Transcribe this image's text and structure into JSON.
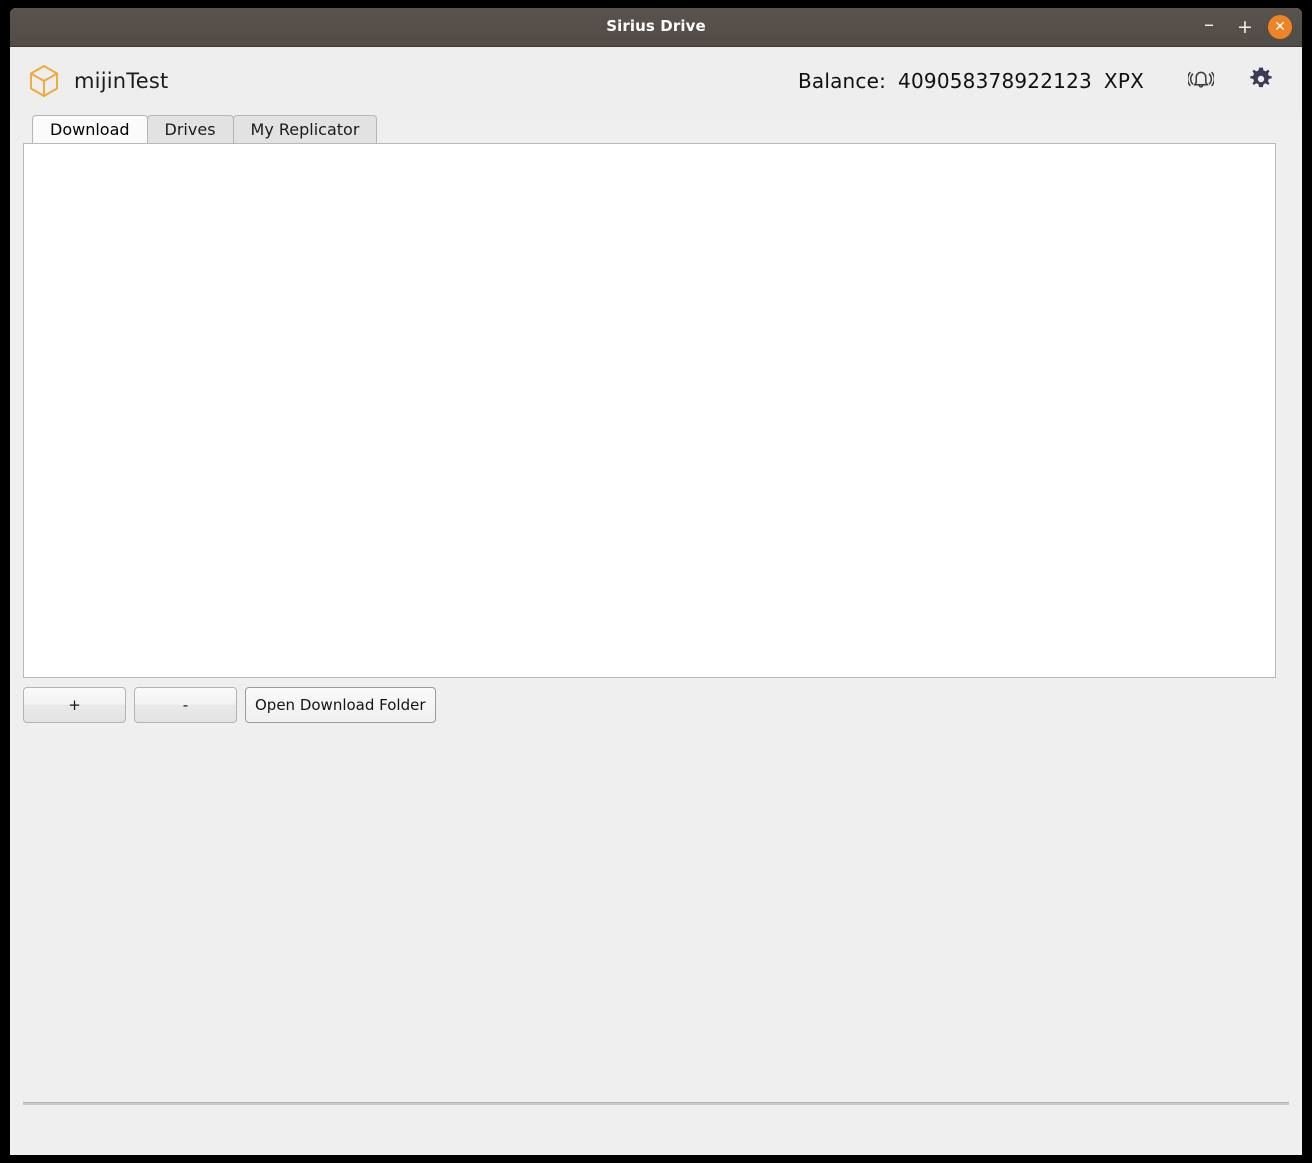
{
  "window": {
    "title": "Sirius Drive",
    "controls": {
      "minimize_label": "–",
      "maximize_label": "+",
      "close_label": "✕"
    },
    "colors": {
      "titlebar_bg": "#564e49",
      "close_button_bg": "#eb8527",
      "brand_accent": "#f0a93a",
      "header_bg": "#eeeeee",
      "panel_bg": "#fafafa"
    }
  },
  "header": {
    "brand_icon": "cube-icon",
    "brand_name": "mijinTest",
    "balance": {
      "label": "Balance:",
      "value": "409058378922123",
      "unit": "XPX"
    },
    "notifications_icon": "bell-ringing-icon",
    "settings_icon": "gear-icon"
  },
  "tabs": [
    {
      "label": "Download",
      "active": true
    },
    {
      "label": "Drives",
      "active": false
    },
    {
      "label": "My Replicator",
      "active": false
    }
  ],
  "main": {
    "download_list": {
      "items": [],
      "empty": true
    },
    "buttons": {
      "add_label": "+",
      "remove_label": "-",
      "open_folder_label": "Open Download Folder"
    }
  }
}
